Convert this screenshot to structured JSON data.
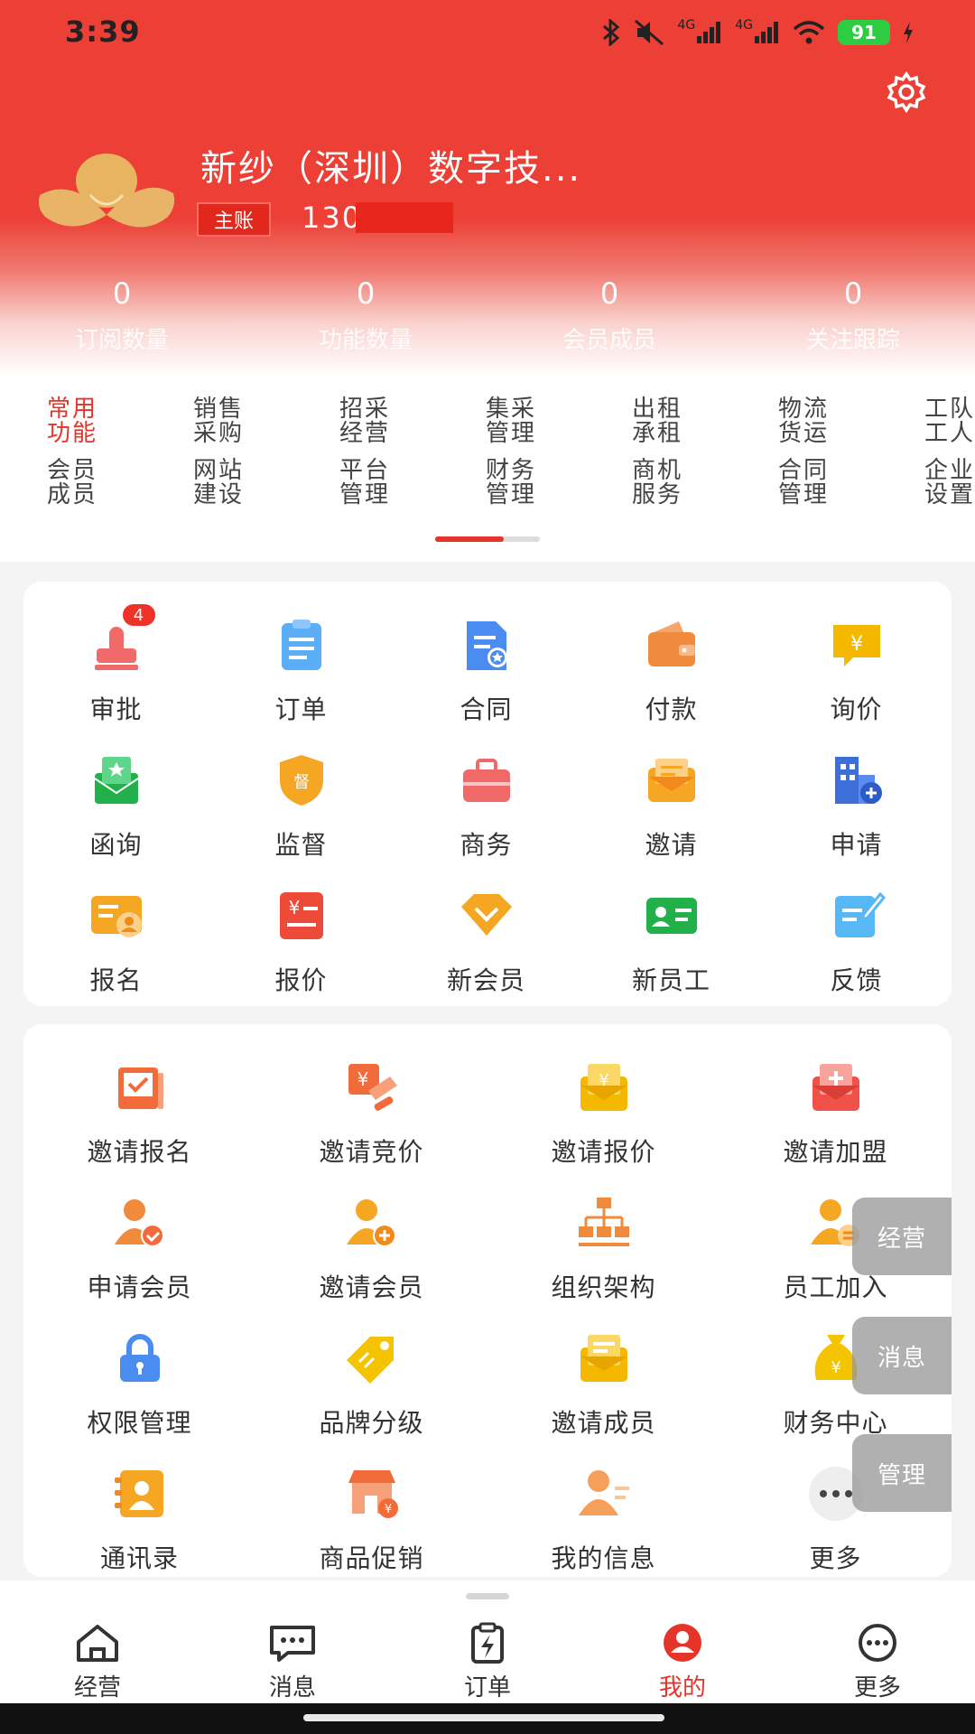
{
  "status": {
    "time": "3:39",
    "battery": "91",
    "signal1": "4G",
    "signal2": "4G"
  },
  "profile": {
    "company": "新纱（深圳）数字技...",
    "role": "主账",
    "phone": "130      912"
  },
  "stats": [
    {
      "value": "0",
      "label": "订阅数量"
    },
    {
      "value": "0",
      "label": "功能数量"
    },
    {
      "value": "0",
      "label": "会员成员"
    },
    {
      "value": "0",
      "label": "关注跟踪"
    }
  ],
  "categories": [
    {
      "line1": "常用",
      "line2": "功能",
      "active": true
    },
    {
      "line1": "销售",
      "line2": "采购"
    },
    {
      "line1": "招采",
      "line2": "经营"
    },
    {
      "line1": "集采",
      "line2": "管理"
    },
    {
      "line1": "出租",
      "line2": "承租"
    },
    {
      "line1": "物流",
      "line2": "货运"
    },
    {
      "line1": "工队",
      "line2": "工人"
    },
    {
      "line1": "会员",
      "line2": "成员"
    },
    {
      "line1": "网站",
      "line2": "建设"
    },
    {
      "line1": "平台",
      "line2": "管理"
    },
    {
      "line1": "财务",
      "line2": "管理"
    },
    {
      "line1": "商机",
      "line2": "服务"
    },
    {
      "line1": "合同",
      "line2": "管理"
    },
    {
      "line1": "企业",
      "line2": "设置"
    }
  ],
  "grid1": [
    {
      "label": "审批",
      "icon": "stamp-icon",
      "badge": "4"
    },
    {
      "label": "订单",
      "icon": "clipboard-icon"
    },
    {
      "label": "合同",
      "icon": "contract-icon"
    },
    {
      "label": "付款",
      "icon": "wallet-icon"
    },
    {
      "label": "询价",
      "icon": "inquiry-icon"
    },
    {
      "label": "函询",
      "icon": "letter-icon"
    },
    {
      "label": "监督",
      "icon": "shield-icon"
    },
    {
      "label": "商务",
      "icon": "briefcase-icon"
    },
    {
      "label": "邀请",
      "icon": "envelope-icon"
    },
    {
      "label": "申请",
      "icon": "building-icon"
    },
    {
      "label": "报名",
      "icon": "signup-card-icon"
    },
    {
      "label": "报价",
      "icon": "quote-icon"
    },
    {
      "label": "新会员",
      "icon": "diamond-icon"
    },
    {
      "label": "新员工",
      "icon": "id-card-icon"
    },
    {
      "label": "反馈",
      "icon": "feedback-icon"
    }
  ],
  "grid2": [
    {
      "label": "邀请报名",
      "icon": "invite-signup-icon"
    },
    {
      "label": "邀请竞价",
      "icon": "invite-bid-icon"
    },
    {
      "label": "邀请报价",
      "icon": "invite-quote-icon"
    },
    {
      "label": "邀请加盟",
      "icon": "invite-join-icon"
    },
    {
      "label": "申请会员",
      "icon": "apply-member-icon"
    },
    {
      "label": "邀请会员",
      "icon": "invite-member-icon"
    },
    {
      "label": "组织架构",
      "icon": "org-chart-icon"
    },
    {
      "label": "员工加入",
      "icon": "staff-join-icon"
    },
    {
      "label": "权限管理",
      "icon": "lock-icon"
    },
    {
      "label": "品牌分级",
      "icon": "tag-icon"
    },
    {
      "label": "邀请成员",
      "icon": "invite-member-mail-icon"
    },
    {
      "label": "财务中心",
      "icon": "money-bag-icon"
    },
    {
      "label": "通讯录",
      "icon": "contacts-icon"
    },
    {
      "label": "商品促销",
      "icon": "store-icon"
    },
    {
      "label": "我的信息",
      "icon": "my-info-icon"
    },
    {
      "label": "更多",
      "icon": "more-dots-icon"
    }
  ],
  "floating": [
    "经营",
    "消息",
    "管理"
  ],
  "tabs": [
    {
      "label": "经营",
      "icon": "home-icon"
    },
    {
      "label": "消息",
      "icon": "message-icon"
    },
    {
      "label": "订单",
      "icon": "order-icon"
    },
    {
      "label": "我的",
      "icon": "profile-icon",
      "active": true
    },
    {
      "label": "更多",
      "icon": "more-icon"
    }
  ],
  "colors": {
    "primary": "#e5352a",
    "hero": "#ec3f35",
    "orange": "#f08a3c",
    "blue": "#4a8cf0",
    "green": "#22b04b",
    "yellow": "#f5b800"
  }
}
